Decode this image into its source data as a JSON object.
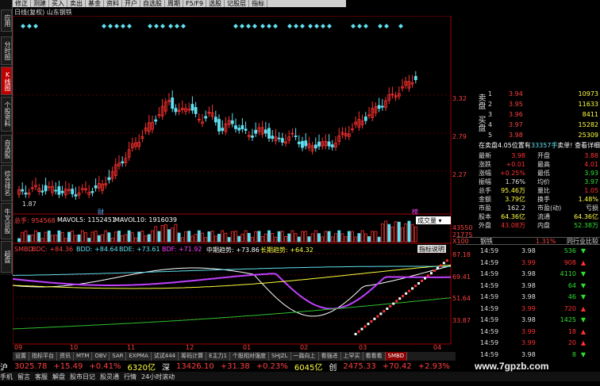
{
  "toolbar": [
    "修正",
    "测建",
    "买入",
    "卖出",
    "基金",
    "资料",
    "开户",
    "自选股",
    "周期",
    "F5/F9",
    "选股",
    "记股层",
    "指标"
  ],
  "left_tabs": [
    {
      "label": "应用",
      "active": false
    },
    {
      "label": "分时图",
      "active": false
    },
    {
      "label": "K线图",
      "active": true
    },
    {
      "label": "个股资料",
      "active": false
    },
    {
      "label": "自选股",
      "active": false
    },
    {
      "label": "综合排名",
      "active": false
    },
    {
      "label": "牛叉诊股",
      "active": false
    },
    {
      "label": "超盘",
      "active": false
    }
  ],
  "chart": {
    "title": "日线(复权)  山东钢铁",
    "price_axis": [
      "3.32",
      "2.79",
      "2.27"
    ],
    "low_label": "1.87",
    "volume_title": "总手: 954568",
    "mavol5": "MAVOL5: 1152451",
    "mavol10": "MAVOL10: 1916039",
    "volume_axis": [
      "43550",
      "21775",
      "X100"
    ],
    "volume_dropdown": "成交量",
    "indicator_line": {
      "name": "SMBD",
      "bdc": "BDC: +84.36",
      "bdd": "BDD: +84.64",
      "bde": "BDE: +73.61",
      "bdf": "BDF: +71.92",
      "mid_trend": "中期趋势: +73.86",
      "long_trend": "长期趋势: +64.32"
    },
    "indicator_help": "指标说明",
    "indicator_axis": [
      "87.18",
      "69.41",
      "51.64",
      "33.87"
    ],
    "time_axis": [
      "09",
      "10",
      "11",
      "12",
      "01",
      "02",
      "03",
      "04"
    ],
    "event_marks": [
      "财",
      "榜"
    ],
    "candle_colors": {
      "up": "#ff3030",
      "down": "#60e0f0"
    }
  },
  "order_book": {
    "sell_label": "卖盘",
    "buy_label": "买盘",
    "sell": [
      {
        "level": "5",
        "price": "3.98",
        "vol": "25309"
      },
      {
        "level": "4",
        "price": "3.97",
        "vol": "15282"
      },
      {
        "level": "3",
        "price": "3.96",
        "vol": "8411"
      },
      {
        "level": "2",
        "price": "3.95",
        "vol": "11633"
      },
      {
        "level": "1",
        "price": "3.94",
        "vol": "10973"
      }
    ],
    "notice_left": "在卖盘4.05位置有",
    "notice_vol": "33357手",
    "notice_right": "卖单! 查看详细"
  },
  "quote": [
    {
      "l1": "最新",
      "v1": "3.98",
      "c1": "#ff3030",
      "l2": "开盘",
      "v2": "3.88",
      "c2": "#ff3030"
    },
    {
      "l1": "涨跌",
      "v1": "+0.01",
      "c1": "#ff3030",
      "l2": "最高",
      "v2": "4.01",
      "c2": "#ff3030"
    },
    {
      "l1": "涨幅",
      "v1": "+0.25%",
      "c1": "#ff3030",
      "l2": "最低",
      "v2": "3.93",
      "c2": "#30e030"
    },
    {
      "l1": "振幅",
      "v1": "1.76%",
      "c1": "#e0e0e0",
      "l2": "均价",
      "v2": "3.97",
      "c2": "#30e030"
    },
    {
      "l1": "总手",
      "v1": "95.46万",
      "c1": "#ffff40",
      "l2": "量比",
      "v2": "1.05",
      "c2": "#ff3030"
    },
    {
      "l1": "金额",
      "v1": "3.79亿",
      "c1": "#ffff40",
      "l2": "换手",
      "v2": "1.48%",
      "c2": "#ffff40"
    },
    {
      "l1": "市盈",
      "v1": "162.2",
      "c1": "#e0e0e0",
      "l2": "市盈(动)",
      "v2": "亏损",
      "c2": "#e0e0e0"
    },
    {
      "l1": "股本",
      "v1": "64.36亿",
      "c1": "#ffff40",
      "l2": "流通",
      "v2": "64.36亿",
      "c2": "#ffff40"
    },
    {
      "l1": "外盘",
      "v1": "43.08万",
      "c1": "#ff3030",
      "l2": "内盘",
      "v2": "52.38万",
      "c2": "#30e030"
    }
  ],
  "sector": {
    "name": "钢铁",
    "change": "1.31%",
    "compare": "同行业比较"
  },
  "ticks": [
    {
      "time": "14:59",
      "price": "3.98",
      "pc": "#e0e0e0",
      "vol": "536",
      "arrow": "▼",
      "ac": "#30e030"
    },
    {
      "time": "14:59",
      "price": "3.99",
      "pc": "#ff3030",
      "vol": "908",
      "arrow": "▲",
      "ac": "#ff3030"
    },
    {
      "time": "14:59",
      "price": "3.98",
      "pc": "#e0e0e0",
      "vol": "4110",
      "arrow": "▼",
      "ac": "#30e030"
    },
    {
      "time": "14:59",
      "price": "3.98",
      "pc": "#e0e0e0",
      "vol": "64",
      "arrow": "▼",
      "ac": "#30e030"
    },
    {
      "time": "14:59",
      "price": "3.98",
      "pc": "#e0e0e0",
      "vol": "46",
      "arrow": "▼",
      "ac": "#30e030"
    },
    {
      "time": "14:59",
      "price": "3.99",
      "pc": "#ff3030",
      "vol": "720",
      "arrow": "▲",
      "ac": "#ff3030"
    },
    {
      "time": "14:59",
      "price": "3.98",
      "pc": "#e0e0e0",
      "vol": "1425",
      "arrow": "▼",
      "ac": "#30e030"
    },
    {
      "time": "14:59",
      "price": "3.99",
      "pc": "#ff3030",
      "vol": "18",
      "arrow": "▲",
      "ac": "#ff3030"
    },
    {
      "time": "14:59",
      "price": "3.99",
      "pc": "#ff3030",
      "vol": "20",
      "arrow": "▲",
      "ac": "#ff3030"
    },
    {
      "time": "14:59",
      "price": "3.98",
      "pc": "#e0e0e0",
      "vol": "8",
      "arrow": "▼",
      "ac": "#30e030"
    },
    {
      "time": "14:59",
      "price": "3.98",
      "pc": "#e0e0e0",
      "vol": "90",
      "arrow": "▼",
      "ac": "#30e030"
    }
  ],
  "bottom_tabs": [
    "设置",
    "指标平台",
    "资讯",
    "MTM",
    "OBV",
    "SAR",
    "EXPMA",
    "试试444",
    "筹码计算",
    "E主力1",
    "个股相对强度",
    "SHJZL",
    "一路向上",
    "看强进",
    "上罕买",
    "看看看",
    "SMBD"
  ],
  "status": {
    "sh_label": "沪",
    "sh_index": "3025.78",
    "sh_change": "+15.49",
    "sh_pct": "+0.41%",
    "sh_amount": "6320亿",
    "sz_label": "深",
    "sz_index": "13426.10",
    "sz_change": "+31.38",
    "sz_pct": "+0.23%",
    "sz_amount": "6045亿",
    "cy_label": "创",
    "cy_index": "2475.33",
    "cy_change": "+70.42",
    "cy_pct": "+2.93%"
  },
  "menu": [
    "手机",
    "留言",
    "客服",
    "解盘",
    "股市日记",
    "股灵通",
    "行情",
    "24小时滚动"
  ],
  "watermark": "www.7gpzb.com"
}
